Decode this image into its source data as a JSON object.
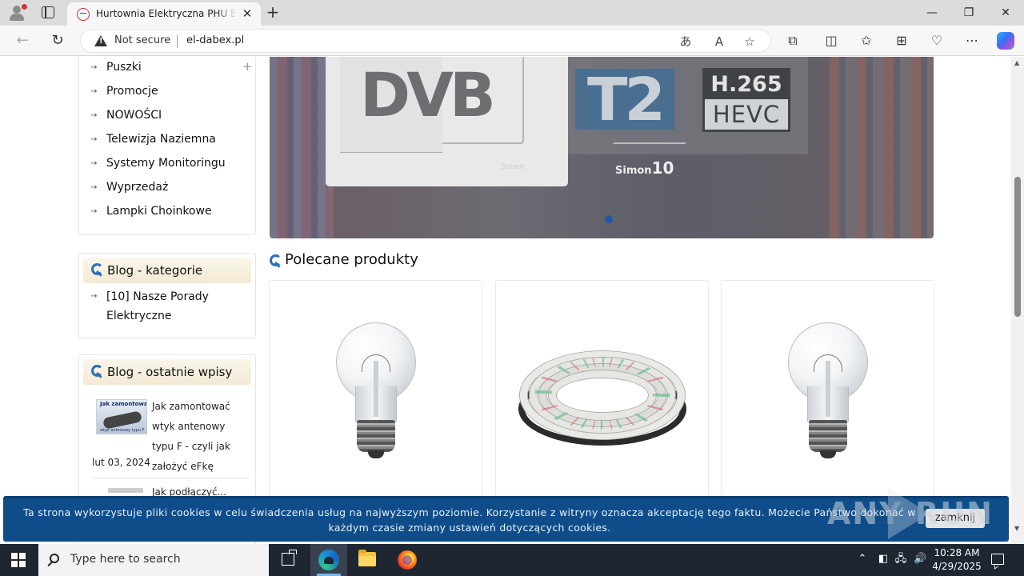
{
  "browser": {
    "tab_title": "Hurtownia Elektryczna PHU EL-DABEX",
    "tab_close": "✕",
    "new_tab": "+",
    "not_secure": "Not secure",
    "url": "el-dabex.pl",
    "window_controls": {
      "minimize": "—",
      "maximize": "❐",
      "close": "✕"
    },
    "icons": [
      "profile-icon",
      "tab-actions-icon",
      "back-icon",
      "refresh-icon",
      "warning-icon",
      "translate-icon",
      "read-aloud-icon",
      "favorite-icon",
      "extensions-icon",
      "split-screen-icon",
      "favorites-icon",
      "collections-icon",
      "browser-essentials-icon",
      "more-icon",
      "copilot-icon"
    ]
  },
  "sidebar": {
    "categories": [
      {
        "label": "Puszki",
        "has_submenu": true
      },
      {
        "label": "Promocje"
      },
      {
        "label": "NOWOŚCI"
      },
      {
        "label": "Telewizja Naziemna"
      },
      {
        "label": "Systemy Monitoringu"
      },
      {
        "label": "Wyprzedaż"
      },
      {
        "label": "Lampki Choinkowe"
      }
    ],
    "submenu_marker": "+",
    "blog_categories": {
      "title": "Blog - kategorie",
      "items": [
        {
          "label": "[10] Nasze Porady Elektryczne"
        }
      ]
    },
    "blog_recent": {
      "title": "Blog - ostatnie wpisy",
      "posts": [
        {
          "title": "Jak zamontować wtyk antenowy typu F - czyli jak założyć eFkę",
          "date": "lut 03, 2024",
          "thumb_line1": "Jak zamontować",
          "thumb_line2": "wtyk antenowy typu F"
        },
        {
          "title": "Jak podłączyć..."
        }
      ]
    }
  },
  "slider": {
    "logo_dvb": "DVB",
    "logo_t2": "T2",
    "logo_hevc_top": "H.265",
    "logo_hevc_bottom": "HEVC",
    "brand": "Simon",
    "brand_number": "10",
    "brand_small": "Simon",
    "active_slide": 1,
    "accent_color": "#1e5aa8"
  },
  "products_section": {
    "title": "Polecane produkty",
    "products": [
      {
        "image": "light-bulb"
      },
      {
        "image": "led-strip"
      },
      {
        "image": "light-bulb"
      }
    ]
  },
  "cookie_bar": {
    "text": "Ta strona wykorzystuje pliki cookies w celu świadczenia usług na najwyższym poziomie. Korzystanie z witryny oznacza akceptację tego faktu. Możecie Państwo dokonać w każdym czasie zmiany ustawień dotyczących cookies.",
    "button": "zamknij",
    "background": "#0f4d8a"
  },
  "watermark": {
    "text": "ANY RUN"
  },
  "taskbar": {
    "search_placeholder": "Type here to search",
    "time": "10:28 AM",
    "date": "4/29/2025",
    "tray_icons": [
      "show-hidden-icon",
      "meet-now-icon",
      "network-icon",
      "volume-icon"
    ]
  }
}
